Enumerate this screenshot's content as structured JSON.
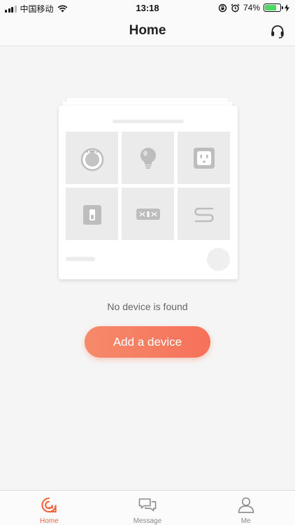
{
  "status_bar": {
    "carrier": "中国移动",
    "time": "13:18",
    "battery_percent": "74%",
    "battery_level": 0.74
  },
  "nav": {
    "title": "Home",
    "right_icon": "headset-icon"
  },
  "illustration": {
    "device_icons": [
      "robot-vacuum-icon",
      "light-bulb-icon",
      "power-socket-icon",
      "wall-switch-icon",
      "remote-panel-icon",
      "light-strip-icon"
    ]
  },
  "empty_state": {
    "message": "No device is found",
    "button_label": "Add a device"
  },
  "tabs": [
    {
      "label": "Home",
      "icon": "home-icon",
      "active": true
    },
    {
      "label": "Message",
      "icon": "message-icon",
      "active": false
    },
    {
      "label": "Me",
      "icon": "profile-icon",
      "active": false
    }
  ],
  "colors": {
    "accent": "#f0663f",
    "button_gradient_start": "#f58a6a",
    "button_gradient_end": "#f7715a",
    "background": "#f5f5f5"
  }
}
